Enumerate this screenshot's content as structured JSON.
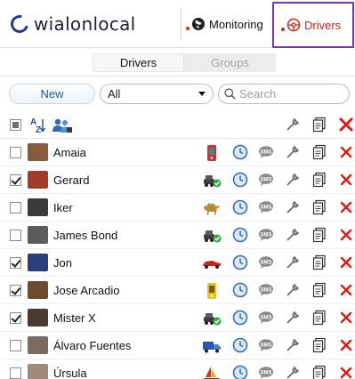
{
  "header": {
    "logo_text": "wialonlocal",
    "nav": [
      {
        "label": "Monitoring",
        "icon": "globe-icon"
      },
      {
        "label": "Drivers",
        "icon": "steering-wheel-icon",
        "active": true
      }
    ]
  },
  "tabs": [
    {
      "label": "Drivers",
      "active": true
    },
    {
      "label": "Groups",
      "active": false
    }
  ],
  "toolbar": {
    "new_label": "New",
    "filter_value": "All",
    "search_placeholder": "Search"
  },
  "colors": {
    "accent": "#d32318",
    "active_outline": "#7b2fc9",
    "link_blue": "#1b5aa6"
  },
  "drivers": [
    {
      "name": "Amaia",
      "checked": false,
      "unit_icon": "phone-icon",
      "avatar_color": "#8b5a3c"
    },
    {
      "name": "Gerard",
      "checked": true,
      "unit_icon": "car-check-icon",
      "avatar_color": "#a13b2a"
    },
    {
      "name": "Iker",
      "checked": false,
      "unit_icon": "camel-icon",
      "avatar_color": "#3a3a3a"
    },
    {
      "name": "James Bond",
      "checked": false,
      "unit_icon": "car-check-icon",
      "avatar_color": "#5b5b5b"
    },
    {
      "name": "Jon",
      "checked": true,
      "unit_icon": "red-car-icon",
      "avatar_color": "#2b3f7a"
    },
    {
      "name": "Jose Arcadio",
      "checked": true,
      "unit_icon": "yellow-phone-icon",
      "avatar_color": "#6b4a2e"
    },
    {
      "name": "Mister X",
      "checked": true,
      "unit_icon": "car-check-icon",
      "avatar_color": "#4a3a32"
    },
    {
      "name": "Álvaro Fuentes",
      "checked": false,
      "unit_icon": "truck-icon",
      "avatar_color": "#7a6a60"
    },
    {
      "name": "Úrsula",
      "checked": false,
      "unit_icon": "boat-icon",
      "avatar_color": "#a08a78"
    }
  ]
}
